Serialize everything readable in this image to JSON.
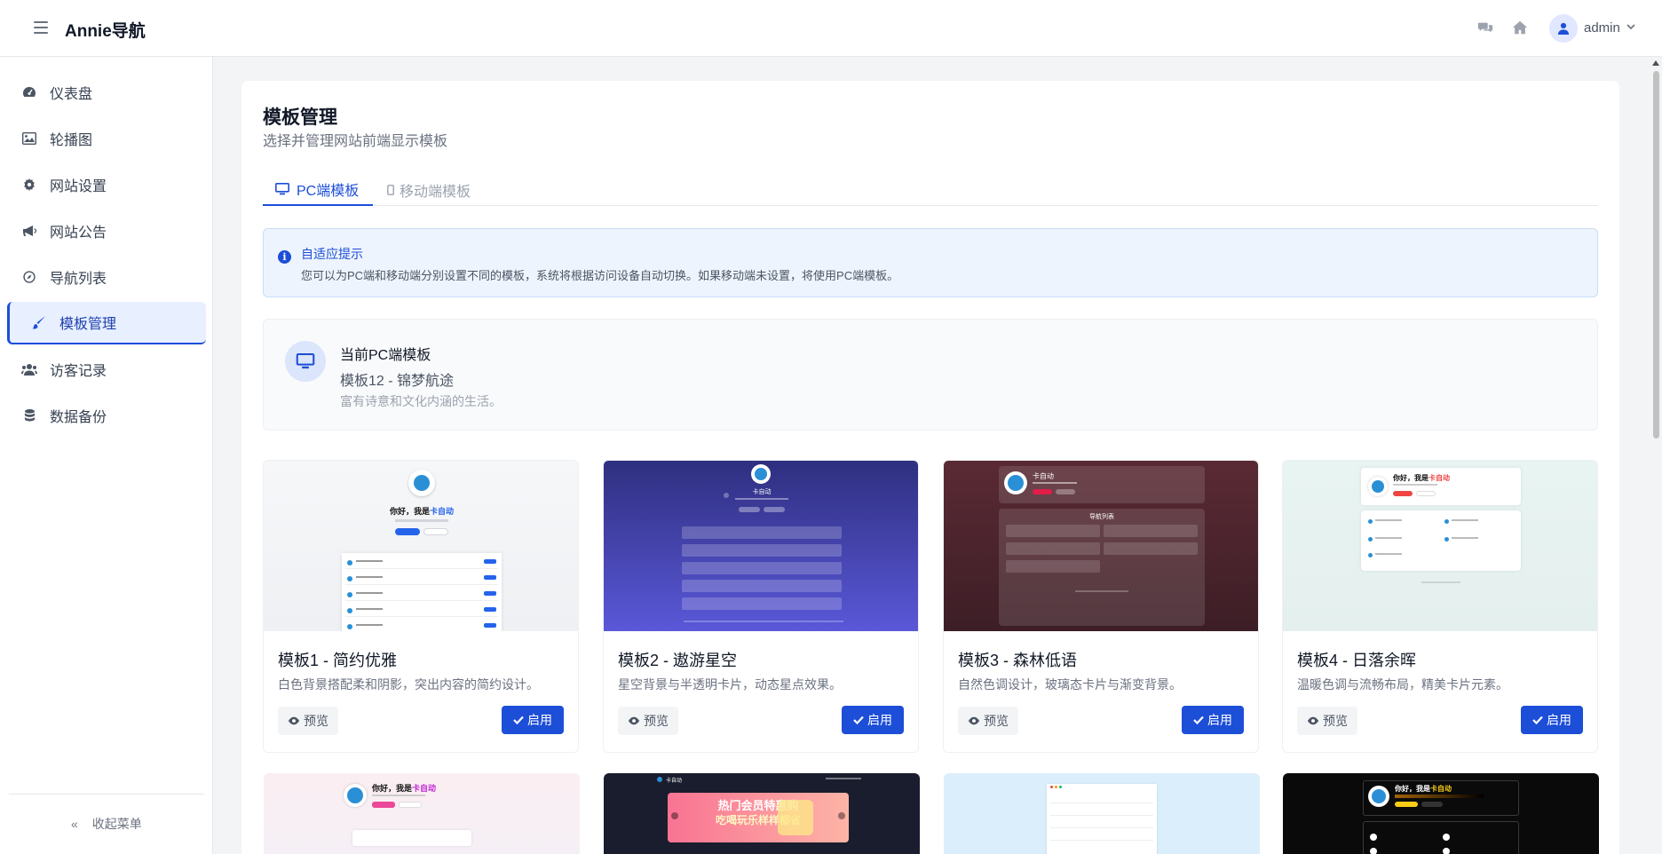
{
  "header": {
    "brand": "Annie导航",
    "user": "admin"
  },
  "sidebar": {
    "items": [
      {
        "label": "仪表盘",
        "icon": "dashboard-icon"
      },
      {
        "label": "轮播图",
        "icon": "image-icon"
      },
      {
        "label": "网站设置",
        "icon": "gear-icon"
      },
      {
        "label": "网站公告",
        "icon": "bullhorn-icon"
      },
      {
        "label": "导航列表",
        "icon": "compass-icon"
      },
      {
        "label": "模板管理",
        "icon": "brush-icon"
      },
      {
        "label": "访客记录",
        "icon": "users-icon"
      },
      {
        "label": "数据备份",
        "icon": "database-icon"
      }
    ],
    "active_index": 5,
    "collapse_label": "收起菜单"
  },
  "page": {
    "title": "模板管理",
    "subtitle": "选择并管理网站前端显示模板"
  },
  "tabs": [
    {
      "label": "PC端模板",
      "active": true
    },
    {
      "label": "移动端模板",
      "active": false
    }
  ],
  "alert": {
    "title": "自适应提示",
    "text": "您可以为PC端和移动端分别设置不同的模板，系统将根据访问设备自动切换。如果移动端未设置，将使用PC端模板。"
  },
  "current": {
    "label": "当前PC端模板",
    "name": "模板12 - 锦梦航途",
    "desc": "富有诗意和文化内涵的生活。"
  },
  "templates": [
    {
      "name": "模板1 - 简约优雅",
      "desc": "白色背景搭配柔和阴影，突出内容的简约设计。",
      "preview": "预览",
      "enable": "启用",
      "thumb_heading": "你好，我是",
      "thumb_highlight": "卡自动"
    },
    {
      "name": "模板2 - 遨游星空",
      "desc": "星空背景与半透明卡片，动态星点效果。",
      "preview": "预览",
      "enable": "启用",
      "thumb_heading": "卡自动"
    },
    {
      "name": "模板3 - 森林低语",
      "desc": "自然色调设计，玻璃态卡片与渐变背景。",
      "preview": "预览",
      "enable": "启用",
      "thumb_heading": "卡自动",
      "thumb_section": "导航列表"
    },
    {
      "name": "模板4 - 日落余晖",
      "desc": "温暖色调与流畅布局，精美卡片元素。",
      "preview": "预览",
      "enable": "启用",
      "thumb_heading": "你好，我是",
      "thumb_highlight": "卡自动"
    }
  ],
  "templates_row2": [
    {
      "thumb_heading": "你好，我是",
      "thumb_highlight": "卡自动"
    },
    {
      "thumb_brand": "卡自动",
      "thumb_banner1": "热门会员特惠购",
      "thumb_banner2": "吃喝玩乐样样都省"
    },
    {},
    {
      "thumb_heading": "你好，我是",
      "thumb_highlight": "卡自动"
    }
  ],
  "colors": {
    "primary": "#1d4ed8",
    "active_bg": "#e8efff",
    "alert_bg": "#eef4fd"
  }
}
